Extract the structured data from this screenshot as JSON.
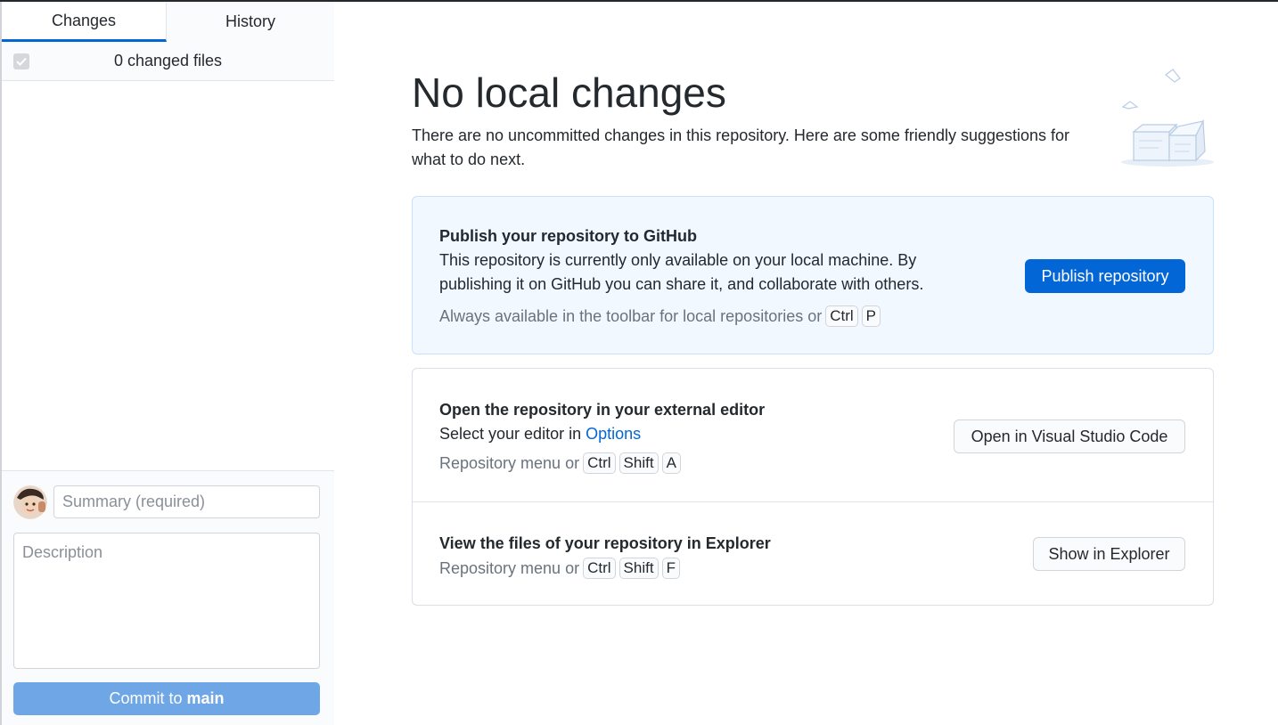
{
  "sidebar": {
    "tabs": [
      {
        "label": "Changes"
      },
      {
        "label": "History"
      }
    ],
    "changed_files_label": "0 changed files",
    "commit": {
      "summary_placeholder": "Summary (required)",
      "description_placeholder": "Description",
      "button_prefix": "Commit to",
      "branch": "main"
    }
  },
  "main": {
    "title": "No local changes",
    "subtitle": "There are no uncommitted changes in this repository. Here are some friendly suggestions for what to do next.",
    "publish": {
      "heading": "Publish your repository to GitHub",
      "body": "This repository is currently only available on your local machine. By publishing it on GitHub you can share it, and collaborate with others.",
      "hint": "Always available in the toolbar for local repositories or",
      "keys": [
        "Ctrl",
        "P"
      ],
      "button": "Publish repository"
    },
    "editor": {
      "heading": "Open the repository in your external editor",
      "body_prefix": "Select your editor in",
      "body_link": "Options",
      "hint": "Repository menu or",
      "keys": [
        "Ctrl",
        "Shift",
        "A"
      ],
      "button": "Open in Visual Studio Code"
    },
    "explorer": {
      "heading": "View the files of your repository in Explorer",
      "hint": "Repository menu or",
      "keys": [
        "Ctrl",
        "Shift",
        "F"
      ],
      "button": "Show in Explorer"
    }
  },
  "colors": {
    "accent": "#0366d6",
    "commit_button": "#6ea6e6",
    "publish_card_bg": "#f1f8ff"
  }
}
